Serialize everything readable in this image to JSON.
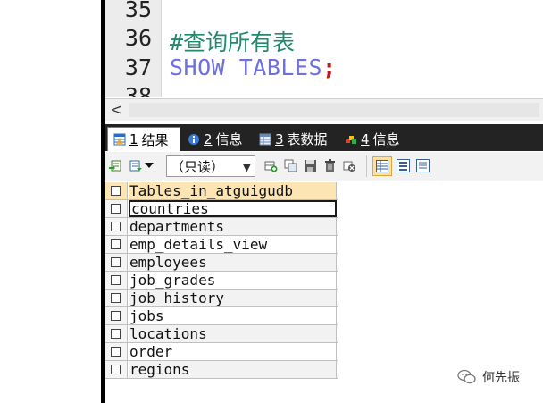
{
  "editor": {
    "lines": [
      {
        "no": "35",
        "text": ""
      },
      {
        "no": "36",
        "text": "#查询所有表"
      },
      {
        "no": "37",
        "keyword": "SHOW TABLES",
        "semicolon": ";"
      },
      {
        "no": "38",
        "text": ""
      }
    ]
  },
  "scrollbar": {
    "left_arrow": "<"
  },
  "tabs": [
    {
      "num": "1",
      "label": "结果",
      "active": true,
      "icon": "result-grid-icon"
    },
    {
      "num": "2",
      "label": "信息",
      "active": false,
      "icon": "info-icon"
    },
    {
      "num": "3",
      "label": "表数据",
      "active": false,
      "icon": "table-data-icon"
    },
    {
      "num": "4",
      "label": "信息",
      "active": false,
      "icon": "info-color-icon"
    }
  ],
  "toolbar": {
    "readonly_label": "（只读）",
    "icons": [
      "export-icon",
      "import-icon",
      "add-row-icon",
      "duplicate-row-icon",
      "save-icon",
      "delete-icon",
      "cancel-icon",
      "grid-view-icon",
      "form-view-icon",
      "text-view-icon"
    ]
  },
  "grid": {
    "header": "Tables_in_atguigudb",
    "rows": [
      "countries",
      "departments",
      "emp_details_view",
      "employees",
      "job_grades",
      "job_history",
      "jobs",
      "locations",
      "order",
      "regions"
    ],
    "selected_index": 0
  },
  "watermark": {
    "text": "何先振"
  },
  "colors": {
    "comment": "#208a6c",
    "keyword": "#6f6fe4",
    "header_bg": "#fde5b3",
    "tabbar_bg": "#232323"
  }
}
